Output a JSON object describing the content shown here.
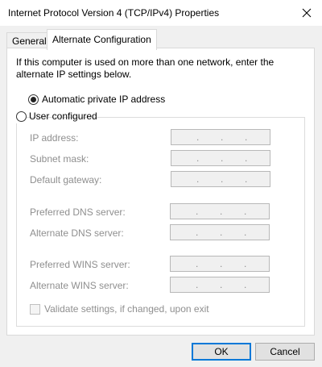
{
  "window": {
    "title": "Internet Protocol Version 4 (TCP/IPv4) Properties",
    "close_icon": "close-icon"
  },
  "tabs": [
    {
      "label": "General",
      "selected": false
    },
    {
      "label": "Alternate Configuration",
      "selected": true
    }
  ],
  "description": "If this computer is used on more than one network, enter the alternate IP settings below.",
  "options": {
    "automatic": {
      "label": "Automatic private IP address",
      "selected": true
    },
    "user": {
      "label": "User configured",
      "selected": false
    }
  },
  "fields": [
    {
      "label": "IP address:",
      "value": ""
    },
    {
      "label": "Subnet mask:",
      "value": ""
    },
    {
      "label": "Default gateway:",
      "value": ""
    },
    {
      "label": "Preferred DNS server:",
      "value": ""
    },
    {
      "label": "Alternate DNS server:",
      "value": ""
    },
    {
      "label": "Preferred WINS server:",
      "value": ""
    },
    {
      "label": "Alternate WINS server:",
      "value": ""
    }
  ],
  "validate": {
    "label": "Validate settings, if changed, upon exit",
    "checked": false
  },
  "buttons": {
    "ok": "OK",
    "cancel": "Cancel"
  },
  "colors": {
    "accent": "#0078d7",
    "disabled_text": "#8f8f8f"
  }
}
